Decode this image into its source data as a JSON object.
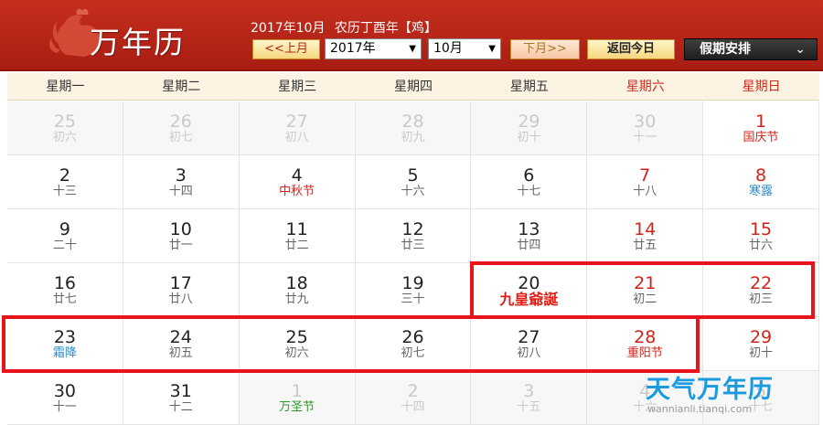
{
  "header": {
    "title": "万年历",
    "date_text": "2017年10月",
    "lunar_text": "农历丁酉年【鸡】",
    "prev_month_label": "<<上月",
    "year_value": "2017年",
    "month_value": "10月",
    "next_month_label": "下月>>",
    "today_label": "返回今日",
    "holiday_label": "假期安排",
    "caret": "▼",
    "holiday_caret": "⌄"
  },
  "weekdays": [
    "星期一",
    "星期二",
    "星期三",
    "星期四",
    "星期五",
    "星期六",
    "星期日"
  ],
  "weeks": [
    [
      {
        "day": "25",
        "lunar": "初六",
        "other": true
      },
      {
        "day": "26",
        "lunar": "初七",
        "other": true
      },
      {
        "day": "27",
        "lunar": "初八",
        "other": true
      },
      {
        "day": "28",
        "lunar": "初九",
        "other": true
      },
      {
        "day": "29",
        "lunar": "初十",
        "other": true
      },
      {
        "day": "30",
        "lunar": "十一",
        "other": true
      },
      {
        "day": "1",
        "lunar": "国庆节",
        "day_style": "red",
        "lunar_style": "red"
      }
    ],
    [
      {
        "day": "2",
        "lunar": "十三"
      },
      {
        "day": "3",
        "lunar": "十四"
      },
      {
        "day": "4",
        "lunar": "中秋节",
        "lunar_style": "red"
      },
      {
        "day": "5",
        "lunar": "十六"
      },
      {
        "day": "6",
        "lunar": "十七"
      },
      {
        "day": "7",
        "lunar": "十八",
        "day_style": "red"
      },
      {
        "day": "8",
        "lunar": "寒露",
        "day_style": "red",
        "lunar_style": "blue"
      }
    ],
    [
      {
        "day": "9",
        "lunar": "二十"
      },
      {
        "day": "10",
        "lunar": "廿一"
      },
      {
        "day": "11",
        "lunar": "廿二"
      },
      {
        "day": "12",
        "lunar": "廿三"
      },
      {
        "day": "13",
        "lunar": "廿四"
      },
      {
        "day": "14",
        "lunar": "廿五",
        "day_style": "red"
      },
      {
        "day": "15",
        "lunar": "廿六",
        "day_style": "red"
      }
    ],
    [
      {
        "day": "16",
        "lunar": "廿七"
      },
      {
        "day": "17",
        "lunar": "廿八"
      },
      {
        "day": "18",
        "lunar": "廿九"
      },
      {
        "day": "19",
        "lunar": "三十"
      },
      {
        "day": "20",
        "lunar": "九皇爺誕",
        "lunar_style": "big"
      },
      {
        "day": "21",
        "lunar": "初二",
        "day_style": "red"
      },
      {
        "day": "22",
        "lunar": "初三",
        "day_style": "red"
      }
    ],
    [
      {
        "day": "23",
        "lunar": "霜降",
        "lunar_style": "blue"
      },
      {
        "day": "24",
        "lunar": "初五"
      },
      {
        "day": "25",
        "lunar": "初六"
      },
      {
        "day": "26",
        "lunar": "初七"
      },
      {
        "day": "27",
        "lunar": "初八"
      },
      {
        "day": "28",
        "lunar": "重阳节",
        "day_style": "red",
        "lunar_style": "red"
      },
      {
        "day": "29",
        "lunar": "初十",
        "day_style": "red"
      }
    ],
    [
      {
        "day": "30",
        "lunar": "十一"
      },
      {
        "day": "31",
        "lunar": "十二"
      },
      {
        "day": "1",
        "lunar": "万圣节",
        "other": true,
        "lunar_style": "green"
      },
      {
        "day": "2",
        "lunar": "十四",
        "other": true
      },
      {
        "day": "3",
        "lunar": "十五",
        "other": true
      },
      {
        "day": "4",
        "lunar": "十六",
        "other": true
      },
      {
        "day": "5",
        "lunar": "十七",
        "other": true
      }
    ]
  ],
  "watermark": {
    "title": "天气万年历",
    "url": "wannianli.tianqi.com"
  }
}
